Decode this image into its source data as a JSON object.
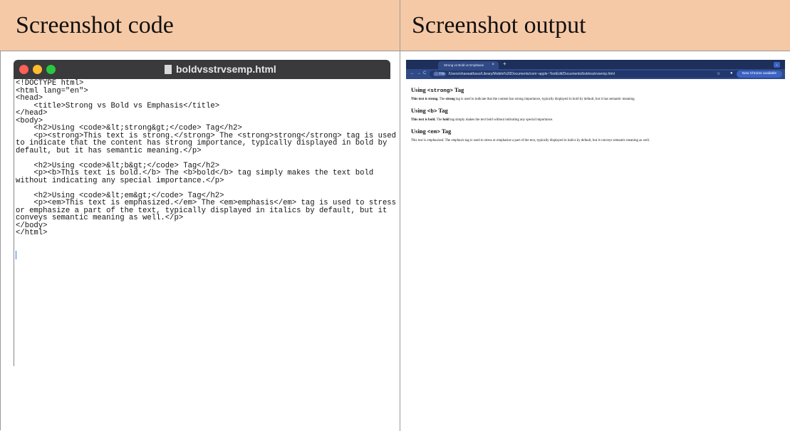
{
  "table": {
    "header_left": "Screenshot code",
    "header_right": "Screenshot output"
  },
  "editor": {
    "filename": "boldvsstrvsemp.html",
    "code_lines": [
      "<!DOCTYPE html>",
      "<html lang=\"en\">",
      "<head>",
      "    <title>Strong vs Bold vs Emphasis</title>",
      "</head>",
      "<body>",
      "    <h2>Using <code>&lt;strong&gt;</code> Tag</h2>",
      "    <p><strong>This text is strong.</strong> The <strong>strong</strong> tag is used",
      "to indicate that the content has strong importance, typically displayed in bold by",
      "default, but it has semantic meaning.</p>",
      "",
      "    <h2>Using <code>&lt;b&gt;</code> Tag</h2>",
      "    <p><b>This text is bold.</b> The <b>bold</b> tag simply makes the text bold",
      "without indicating any special importance.</p>",
      "",
      "    <h2>Using <code>&lt;em&gt;</code> Tag</h2>",
      "    <p><em>This text is emphasized.</em> The <em>emphasis</em> tag is used to stress",
      "or emphasize a part of the text, typically displayed in italics by default, but it",
      "conveys semantic meaning as well.</p>",
      "</body>",
      "</html>"
    ]
  },
  "browser": {
    "tab_title": "Strong vs Bold vs Emphasis",
    "tab_close": "×",
    "new_tab": "+",
    "menu": "⌄",
    "url_chip": "File",
    "url": "/Users/shaswathaso/Library/Mobile%20Documents/com~apple~TextEdit/Documents/boldvsstrvsemp.html",
    "update_label": "New Chrome available",
    "sections": [
      {
        "heading_prefix": "Using ",
        "heading_code": "<strong>",
        "heading_suffix": " Tag",
        "lead": "This text is strong.",
        "mid1": " The ",
        "word": "strong",
        "rest": " tag is used to indicate that the content has strong importance, typically displayed in bold by default, but it has semantic meaning."
      },
      {
        "heading_prefix": "Using ",
        "heading_code": "<b>",
        "heading_suffix": " Tag",
        "lead": "This text is bold.",
        "mid1": " The ",
        "word": "bold",
        "rest": " tag simply makes the text bold without indicating any special importance."
      },
      {
        "heading_prefix": "Using ",
        "heading_code": "<em>",
        "heading_suffix": " Tag",
        "lead": "This text is emphasized.",
        "mid1": " The ",
        "word": "emphasis",
        "rest": " tag is used to stress or emphasize a part of the text, typically displayed in italics by default, but it conveys semantic meaning as well."
      }
    ]
  }
}
